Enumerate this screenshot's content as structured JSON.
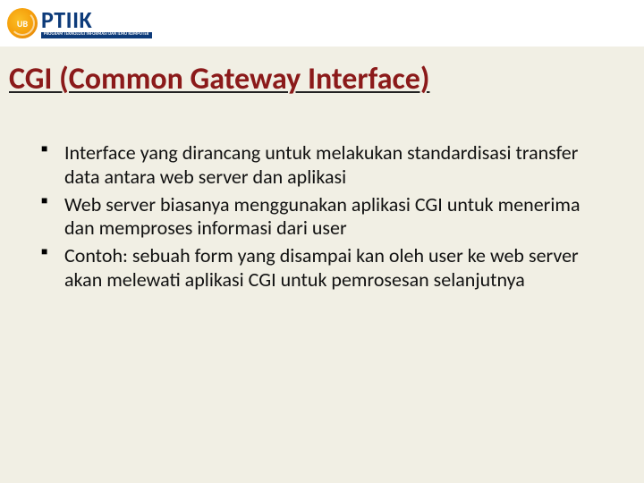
{
  "logo": {
    "name": "PTIIK",
    "subtitle": "PROGRAM TEKNOLOGI INFORMASI DAN ILMU KOMPUTER",
    "mark_text": "UB"
  },
  "slide": {
    "title": "CGI (Common Gateway Interface)",
    "bullets": [
      "Interface yang dirancang untuk melakukan standardisasi transfer data antara web server dan aplikasi",
      "Web server biasanya menggunakan aplikasi CGI untuk menerima dan memproses informasi dari user",
      "Contoh: sebuah form yang disampai kan oleh user ke web server akan melewati aplikasi CGI untuk pemrosesan selanjutnya"
    ]
  }
}
